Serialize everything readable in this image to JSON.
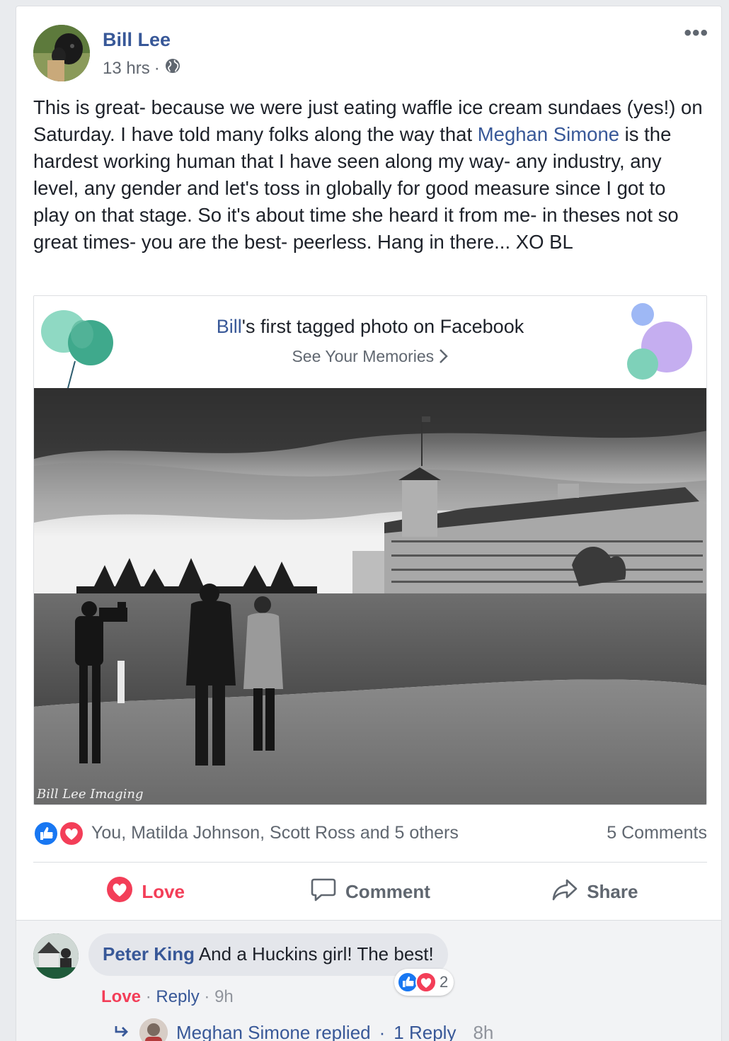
{
  "post": {
    "author": "Bill Lee",
    "time": "13 hrs",
    "separator": "·",
    "privacy_icon": "globe-icon",
    "more_icon": "more-horizontal-icon",
    "text_part1": "This is great- because we were just eating waffle ice cream sundaes (yes!) on Saturday. I have told many folks along the way that ",
    "mention": "Meghan Simone",
    "text_part2": " is the hardest working human that I have seen along my way- any industry, any level, any gender and let's toss in globally for good measure since I got to play on that stage. So it's about time she heard it from me- in theses not so great times- you are the best- peerless. Hang in there... XO BL"
  },
  "memory": {
    "name": "Bill",
    "title_rest": "'s first tagged photo on Facebook",
    "link": "See Your Memories",
    "link_icon": "chevron-right-icon",
    "watermark": "Bill Lee Imaging"
  },
  "reactions": {
    "icons": [
      "like-icon",
      "love-icon"
    ],
    "names": "You, Matilda Johnson, Scott Ross and 5 others",
    "comments": "5 Comments"
  },
  "actions": [
    {
      "label": "Love",
      "icon": "love-icon"
    },
    {
      "label": "Comment",
      "icon": "comment-icon"
    },
    {
      "label": "Share",
      "icon": "share-icon"
    }
  ],
  "comment": {
    "author": "Peter King",
    "text": "And a Huckins girl! The best!",
    "reaction_count": "2",
    "love": "Love",
    "reply": "Reply",
    "time": "9h",
    "sep": "·"
  },
  "reply": {
    "text": "Meghan Simone replied",
    "sep": "·",
    "count": "1 Reply",
    "time": "8h",
    "icon": "reply-arrow-icon"
  },
  "colors": {
    "link": "#385898",
    "love": "#f33e58",
    "like": "#1877f2",
    "muted": "#606770"
  }
}
